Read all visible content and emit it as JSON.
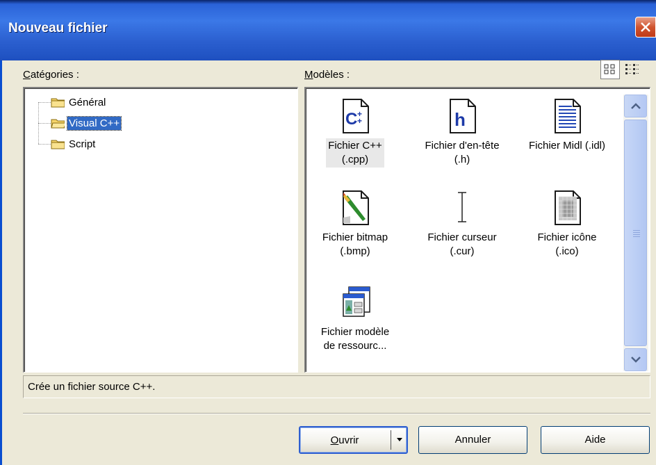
{
  "window": {
    "title": "Nouveau fichier"
  },
  "labels": {
    "categories_prefix": "C",
    "categories_rest": "atégories :",
    "templates_prefix": "M",
    "templates_rest": "odèles :"
  },
  "categories": [
    {
      "label": "Général",
      "selected": false
    },
    {
      "label": "Visual C++",
      "selected": true
    },
    {
      "label": "Script",
      "selected": false
    }
  ],
  "templates": [
    {
      "line1": "Fichier C++",
      "line2": "(.cpp)",
      "icon": "cpp-file-icon",
      "selected": true
    },
    {
      "line1": "Fichier d'en-tête",
      "line2": "(.h)",
      "icon": "header-file-icon",
      "selected": false
    },
    {
      "line1": "Fichier Midl (.idl)",
      "line2": "",
      "icon": "idl-file-icon",
      "selected": false
    },
    {
      "line1": "Fichier bitmap",
      "line2": "(.bmp)",
      "icon": "bitmap-file-icon",
      "selected": false
    },
    {
      "line1": "Fichier curseur",
      "line2": "(.cur)",
      "icon": "cursor-file-icon",
      "selected": false
    },
    {
      "line1": "Fichier icône",
      "line2": "(.ico)",
      "icon": "icon-file-icon",
      "selected": false
    },
    {
      "line1": "Fichier modèle",
      "line2": "de ressourc...",
      "icon": "resource-template-icon",
      "selected": false
    }
  ],
  "status": {
    "text": "Crée un fichier source C++."
  },
  "buttons": {
    "open_prefix": "O",
    "open_rest": "uvrir",
    "cancel": "Annuler",
    "help": "Aide"
  },
  "colors": {
    "titlebar": "#2b5fcf",
    "selection": "#316ac5",
    "dialog_bg": "#ece9d8"
  }
}
